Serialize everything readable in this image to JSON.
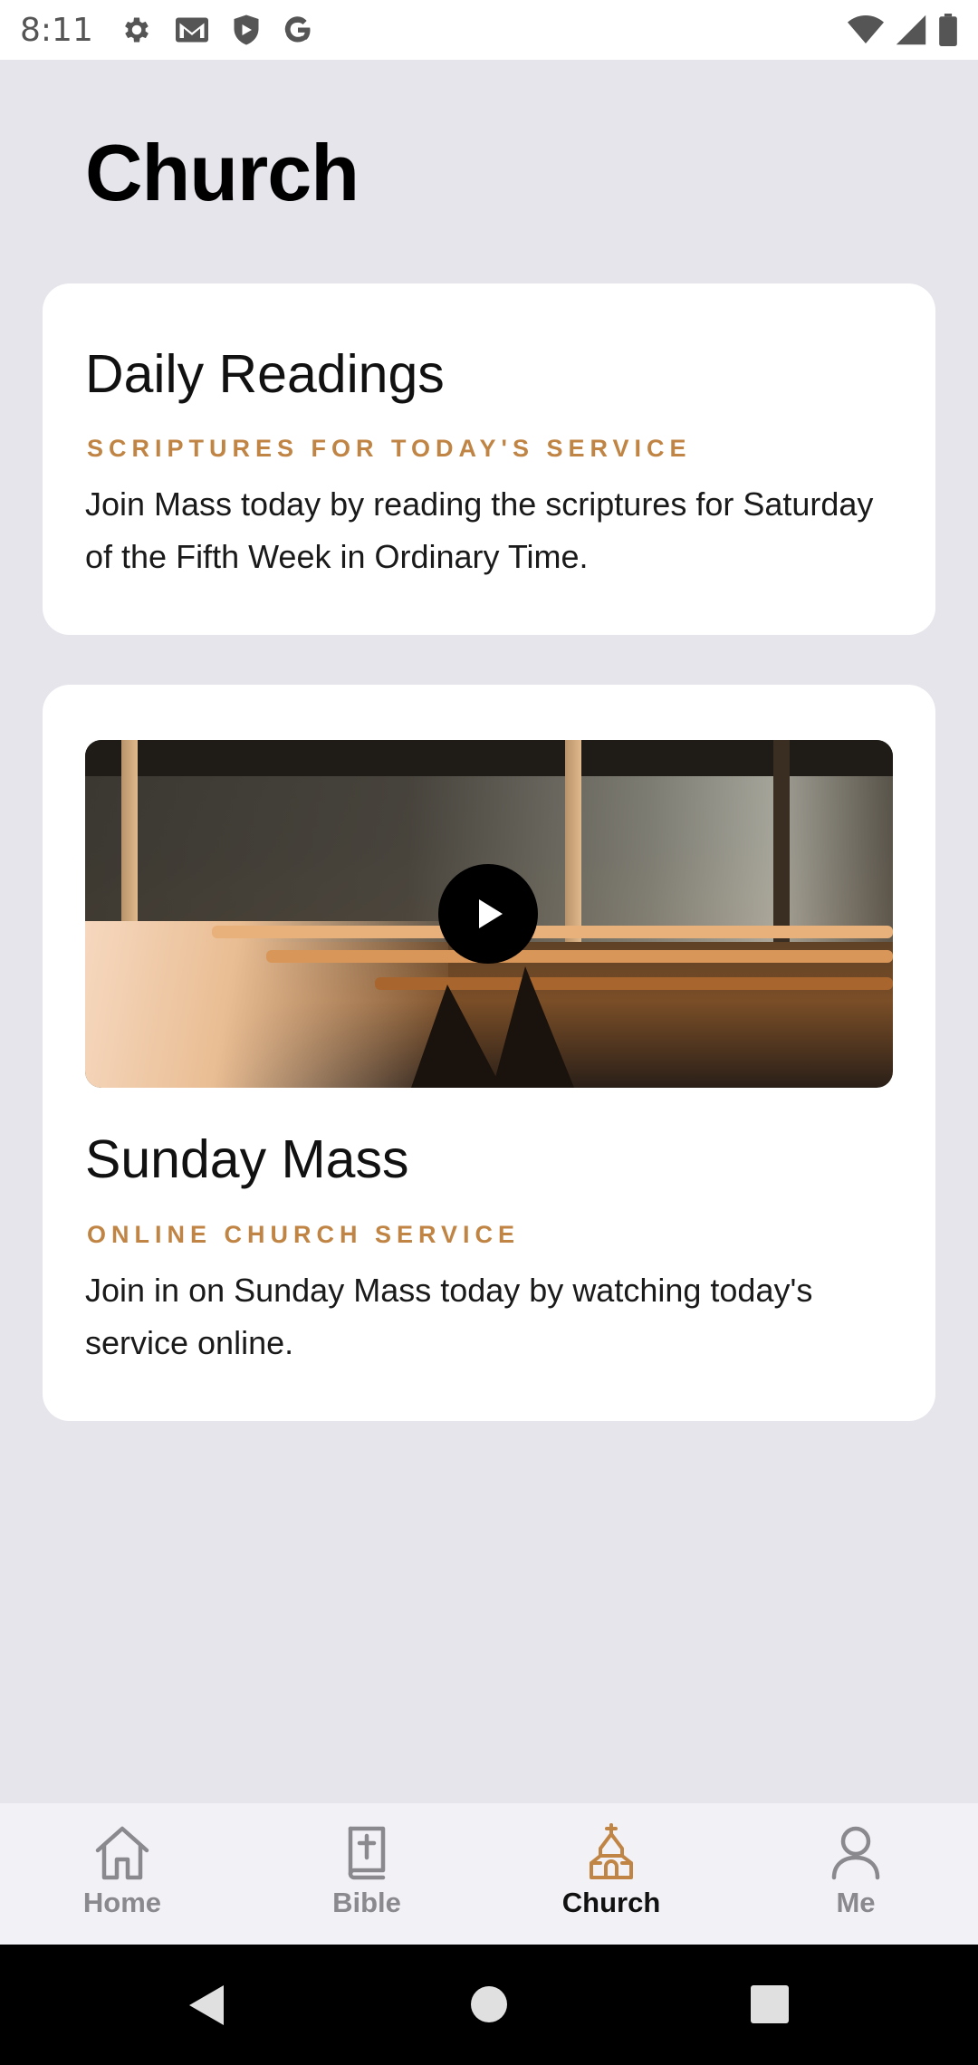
{
  "status_bar": {
    "time": "8:11",
    "icons_left": [
      "settings-icon",
      "gmail-icon",
      "shield-icon",
      "google-icon"
    ],
    "icons_right": [
      "wifi-icon",
      "signal-icon",
      "battery-icon"
    ]
  },
  "page": {
    "title": "Church"
  },
  "daily_readings": {
    "title": "Daily Readings",
    "subtitle": "SCRIPTURES FOR TODAY'S SERVICE",
    "body": "Join Mass today by reading the scriptures for Saturday of the Fifth Week in Ordinary Time."
  },
  "sunday_mass": {
    "title": "Sunday Mass",
    "subtitle": "ONLINE CHURCH SERVICE",
    "body": "Join in on Sunday Mass today by watching today's service online."
  },
  "bottom_nav": {
    "items": [
      {
        "label": "Home",
        "icon": "home-icon"
      },
      {
        "label": "Bible",
        "icon": "bible-icon"
      },
      {
        "label": "Church",
        "icon": "church-icon"
      },
      {
        "label": "Me",
        "icon": "person-icon"
      }
    ],
    "active": "Church"
  },
  "colors": {
    "accent": "#c08544",
    "background": "#e6e5eb",
    "card": "#ffffff"
  }
}
